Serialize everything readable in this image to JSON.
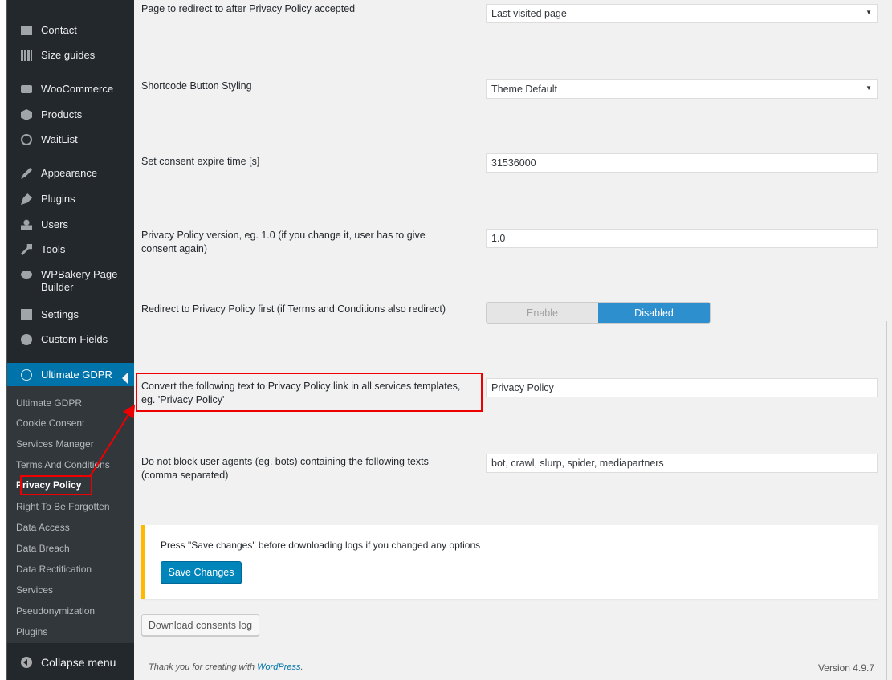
{
  "sidebar": {
    "items": [
      {
        "label": "Contact",
        "icon": "mail-icon"
      },
      {
        "label": "Size guides",
        "icon": "grid-icon"
      },
      {
        "label": "WooCommerce",
        "icon": "woocommerce-icon"
      },
      {
        "label": "Products",
        "icon": "box-icon"
      },
      {
        "label": "WaitList",
        "icon": "clock-icon"
      },
      {
        "label": "Appearance",
        "icon": "brush-icon"
      },
      {
        "label": "Plugins",
        "icon": "plug-icon"
      },
      {
        "label": "Users",
        "icon": "user-icon"
      },
      {
        "label": "Tools",
        "icon": "wrench-icon"
      },
      {
        "label": "WPBakery Page Builder",
        "icon": "wpbakery-icon"
      },
      {
        "label": "Settings",
        "icon": "settings-icon"
      },
      {
        "label": "Custom Fields",
        "icon": "gear-icon"
      },
      {
        "label": "Ultimate GDPR",
        "icon": "shield-icon"
      }
    ],
    "submenu": [
      "Ultimate GDPR",
      "Cookie Consent",
      "Services Manager",
      "Terms And Conditions",
      "Privacy Policy",
      "Right To Be Forgotten",
      "Data Access",
      "Data Breach",
      "Data Rectification",
      "Services",
      "Pseudonymization",
      "Plugins"
    ],
    "collapse_label": "Collapse menu"
  },
  "settings": {
    "redirect_label": "Page to redirect to after Privacy Policy accepted",
    "redirect_value": "Last visited page",
    "button_styling_label": "Shortcode Button Styling",
    "button_styling_value": "Theme Default",
    "expire_label": "Set consent expire time [s]",
    "expire_value": "31536000",
    "version_label": "Privacy Policy version, eg. 1.0 (if you change it, user has to give consent again)",
    "version_value": "1.0",
    "redirect_first_label": "Redirect to Privacy Policy first (if Terms and Conditions also redirect)",
    "toggle_enable": "Enable",
    "toggle_disabled": "Disabled",
    "convert_label": "Convert the following text to Privacy Policy link in all services templates, eg. 'Privacy Policy'",
    "convert_value": "Privacy Policy",
    "bots_label": "Do not block user agents (eg. bots) containing the following texts (comma separated)",
    "bots_value": "bot, crawl, slurp, spider, mediapartners"
  },
  "notice": {
    "text": "Press \"Save changes\" before downloading logs if you changed any options",
    "save_label": "Save Changes"
  },
  "download_label": "Download consents log",
  "footer": {
    "thanks_prefix": "Thank you for creating with ",
    "wordpress_link": "WordPress",
    "thanks_suffix": ".",
    "version": "Version 4.9.7"
  },
  "colors": {
    "sidebar_bg": "#23282d",
    "submenu_bg": "#32373c",
    "current_bg": "#0073aa",
    "primary_button": "#0085ba",
    "toggle_on": "#2e8fcf",
    "highlight_red": "#e00000",
    "notice_border": "#ffb900"
  }
}
